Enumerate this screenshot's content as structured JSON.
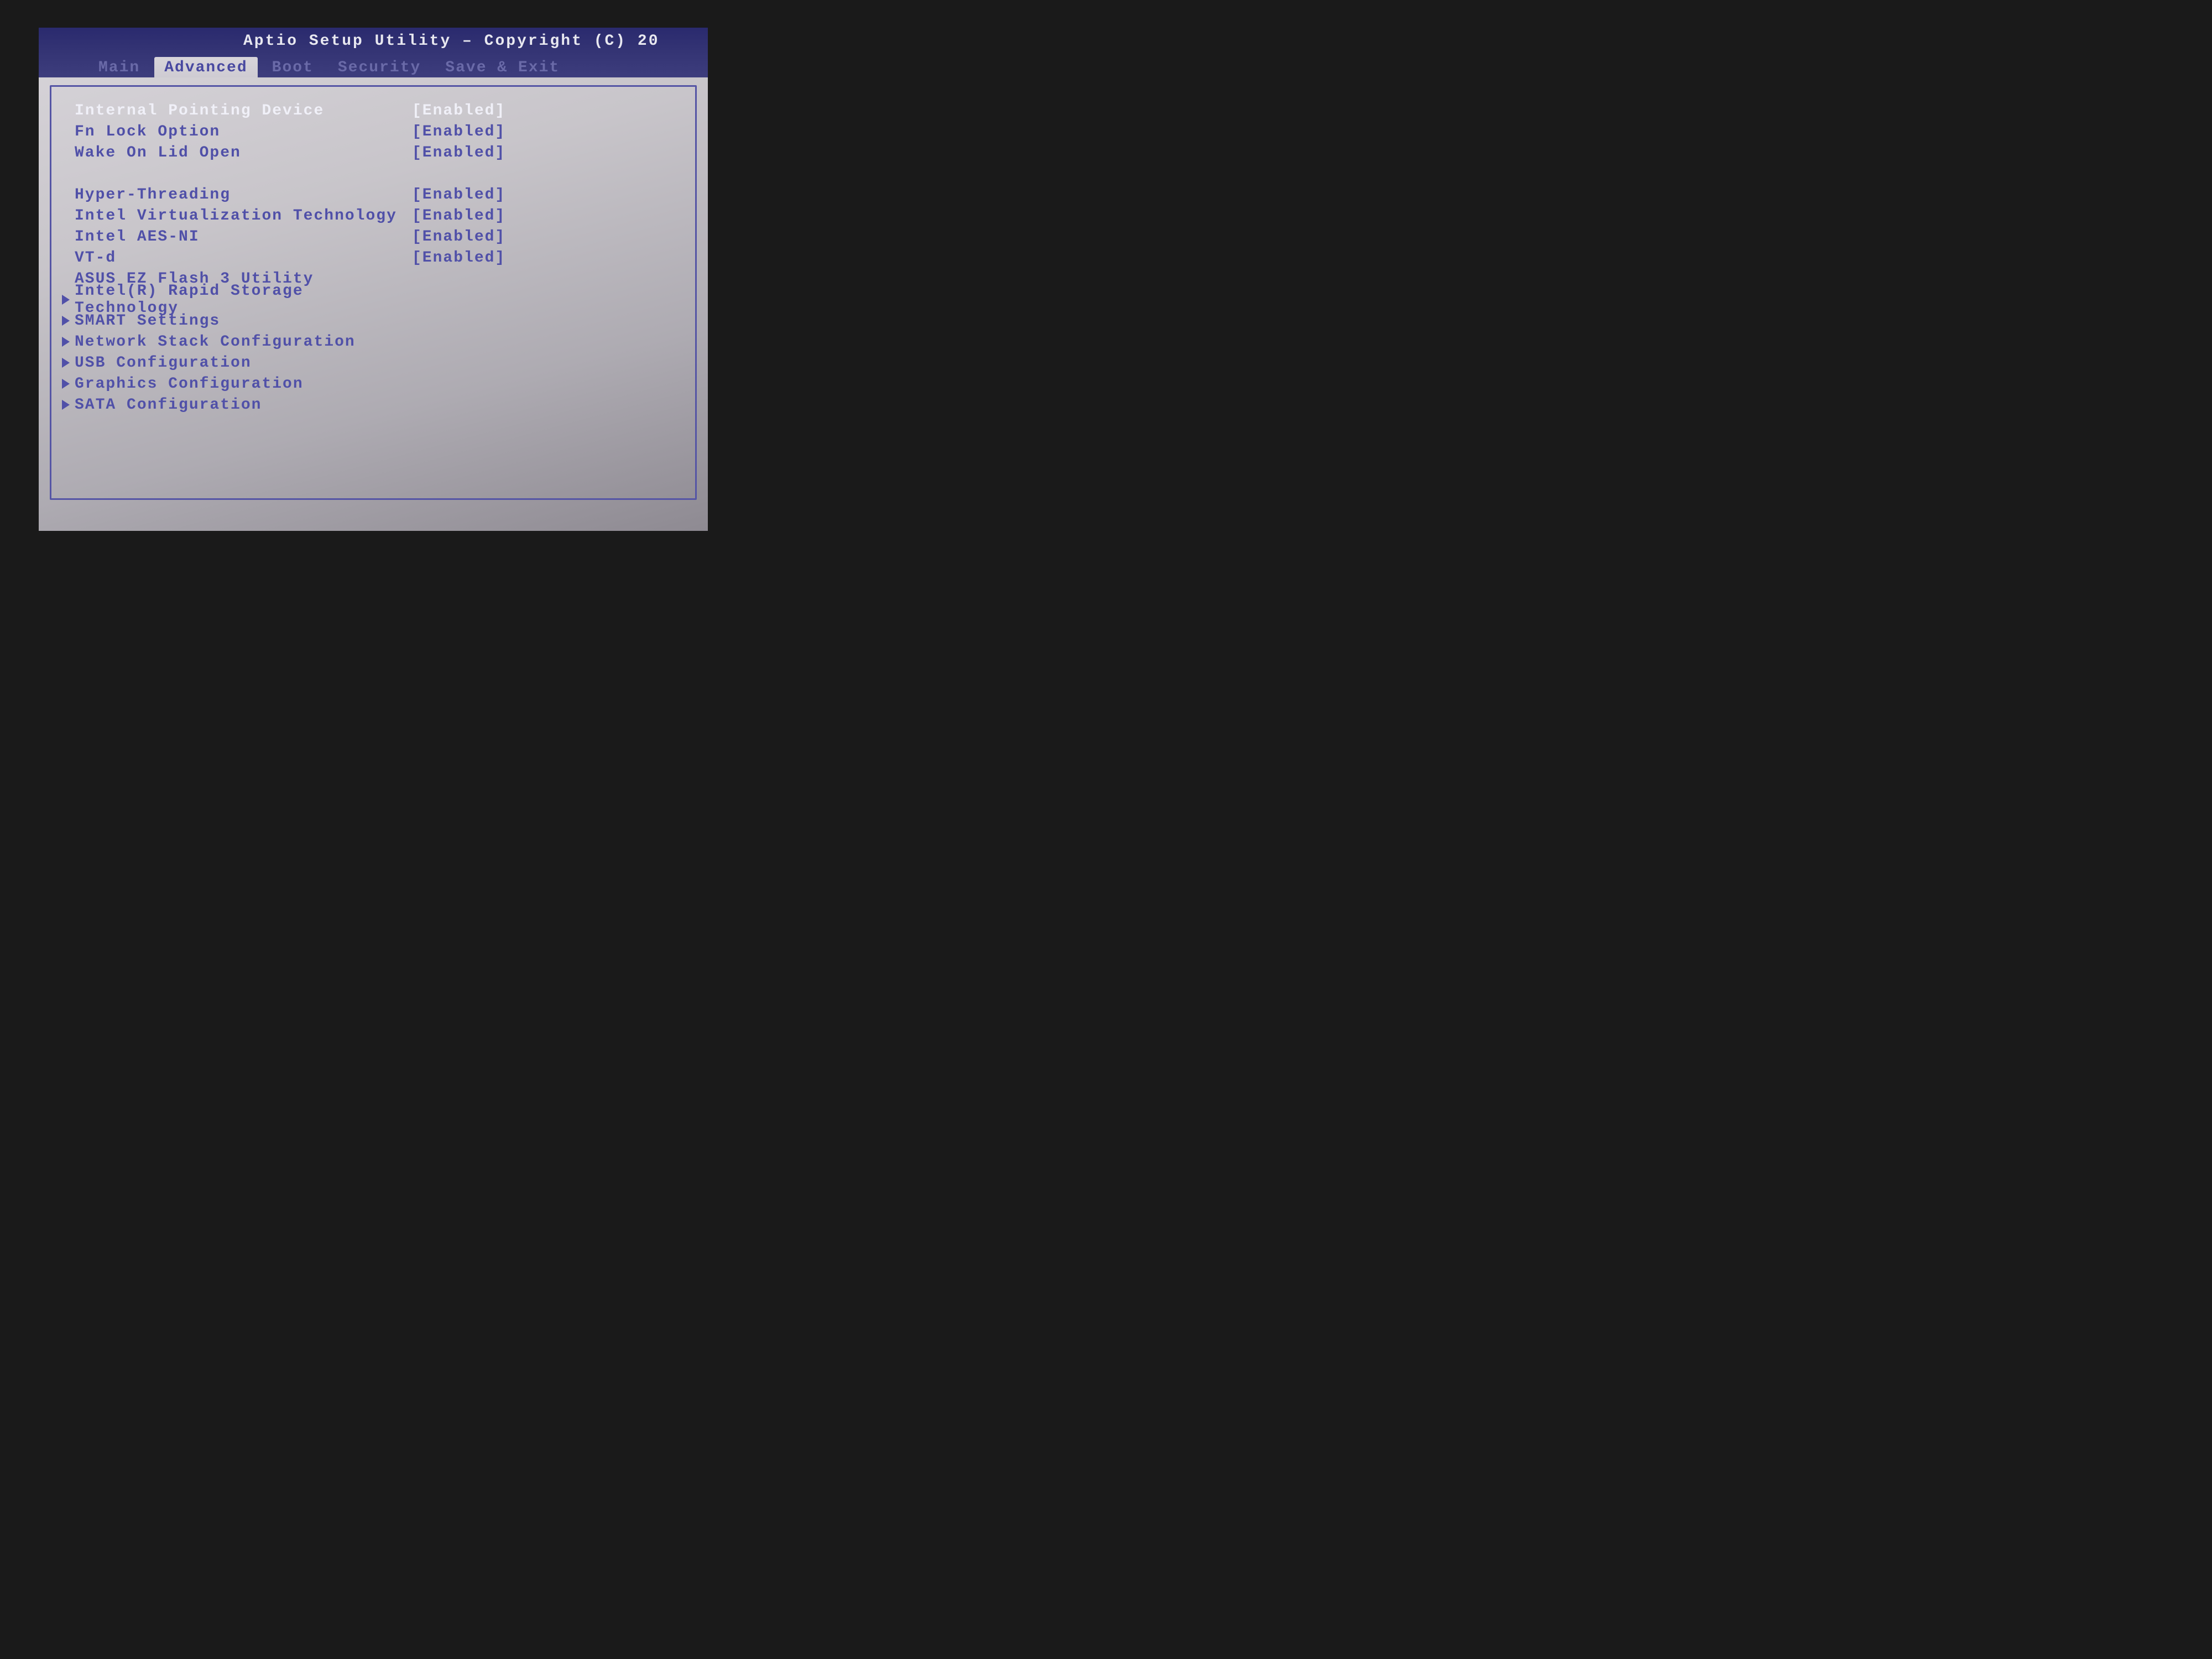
{
  "header": {
    "title": "Aptio Setup Utility – Copyright (C) 20"
  },
  "tabs": [
    {
      "label": "Main",
      "active": false
    },
    {
      "label": "Advanced",
      "active": true
    },
    {
      "label": "Boot",
      "active": false
    },
    {
      "label": "Security",
      "active": false
    },
    {
      "label": "Save & Exit",
      "active": false
    }
  ],
  "options": [
    {
      "label": "Internal Pointing Device",
      "value": "[Enabled]",
      "submenu": false,
      "selected": true
    },
    {
      "label": "Fn Lock Option",
      "value": "[Enabled]",
      "submenu": false,
      "selected": false
    },
    {
      "label": "Wake On Lid Open",
      "value": "[Enabled]",
      "submenu": false,
      "selected": false
    },
    {
      "spacer": true
    },
    {
      "label": "Hyper-Threading",
      "value": "[Enabled]",
      "submenu": false,
      "selected": false
    },
    {
      "label": "Intel Virtualization Technology",
      "value": "[Enabled]",
      "submenu": false,
      "selected": false
    },
    {
      "label": "Intel AES-NI",
      "value": "[Enabled]",
      "submenu": false,
      "selected": false
    },
    {
      "label": "VT-d",
      "value": "[Enabled]",
      "submenu": false,
      "selected": false
    },
    {
      "label": "ASUS EZ Flash 3 Utility",
      "value": "",
      "submenu": false,
      "selected": false
    },
    {
      "label": "Intel(R) Rapid Storage Technology",
      "value": "",
      "submenu": true,
      "selected": false
    },
    {
      "label": "SMART Settings",
      "value": "",
      "submenu": true,
      "selected": false
    },
    {
      "label": "Network Stack Configuration",
      "value": "",
      "submenu": true,
      "selected": false
    },
    {
      "label": "USB Configuration",
      "value": "",
      "submenu": true,
      "selected": false
    },
    {
      "label": "Graphics Configuration",
      "value": "",
      "submenu": true,
      "selected": false
    },
    {
      "label": "SATA Configuration",
      "value": "",
      "submenu": true,
      "selected": false
    }
  ]
}
